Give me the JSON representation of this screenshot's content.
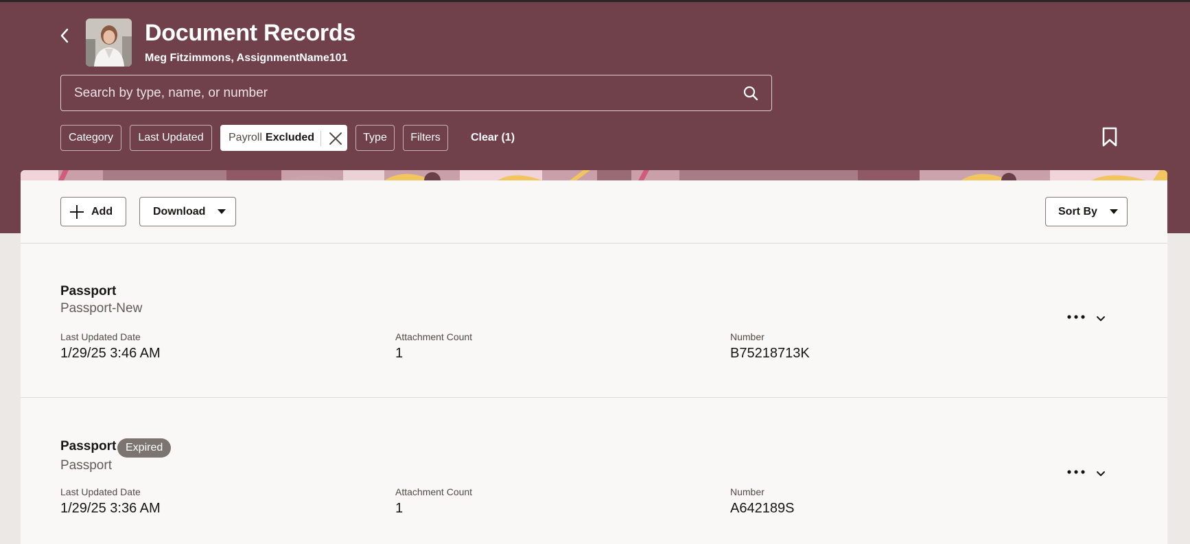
{
  "header": {
    "title": "Document Records",
    "subtitle": "Meg Fitzimmons, AssignmentName101",
    "search_placeholder": "Search by type, name, or number",
    "filters": {
      "category": "Category",
      "last_updated": "Last Updated",
      "payroll_prefix": "Payroll",
      "payroll_value": "Excluded",
      "type": "Type",
      "filters": "Filters",
      "clear": "Clear (1)"
    }
  },
  "toolbar": {
    "add_label": "Add",
    "download_label": "Download",
    "sort_label": "Sort By"
  },
  "records": [
    {
      "title": "Passport",
      "subtitle": "Passport-New",
      "badge": "",
      "last_updated_label": "Last Updated Date",
      "last_updated": "1/29/25 3:46 AM",
      "attachment_label": "Attachment Count",
      "attachment_count": "1",
      "number_label": "Number",
      "number": "B75218713K"
    },
    {
      "title": "Passport",
      "subtitle": "Passport",
      "badge": "Expired",
      "last_updated_label": "Last Updated Date",
      "last_updated": "1/29/25 3:36 AM",
      "attachment_label": "Attachment Count",
      "attachment_count": "1",
      "number_label": "Number",
      "number": "A642189S"
    }
  ],
  "colors": {
    "header_bg": "#70404b",
    "panel_bg": "#f9f8f6",
    "badge_bg": "#7b7470"
  },
  "icons": [
    "back-chevron-icon",
    "search-icon",
    "close-icon",
    "bookmark-icon",
    "plus-icon",
    "caret-down-icon",
    "more-horizontal-icon",
    "chevron-down-icon"
  ]
}
